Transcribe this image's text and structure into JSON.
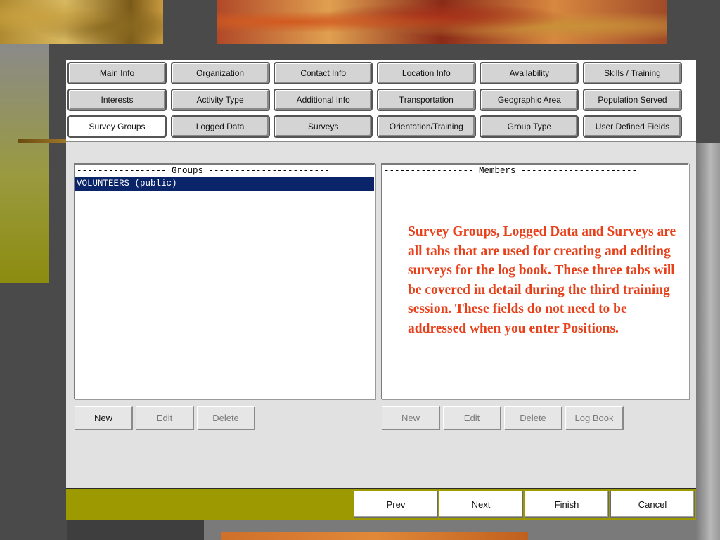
{
  "tabs": {
    "row1": [
      "Main Info",
      "Organization",
      "Contact Info",
      "Location Info",
      "Availability",
      "Skills / Training"
    ],
    "row2": [
      "Interests",
      "Activity Type",
      "Additional Info",
      "Transportation",
      "Geographic Area",
      "Population Served"
    ],
    "row3": [
      "Survey Groups",
      "Logged Data",
      "Surveys",
      "Orientation/Training",
      "Group Type",
      "User Defined Fields"
    ],
    "active": "Survey Groups"
  },
  "groups_panel": {
    "header": "----------------- Groups -----------------------",
    "items": [
      "VOLUNTEERS (public)"
    ],
    "selected_index": 0
  },
  "members_panel": {
    "header": "----------------- Members ----------------------"
  },
  "note": "Survey Groups, Logged Data and Surveys are all tabs that are used for creating and editing surveys for the log book.  These three tabs will be covered in detail during the third training session.  These fields do not need to be addressed when you enter Positions.",
  "groups_buttons": {
    "new": "New",
    "edit": "Edit",
    "delete": "Delete"
  },
  "members_buttons": {
    "new": "New",
    "edit": "Edit",
    "delete": "Delete",
    "log_book": "Log Book"
  },
  "nav": {
    "prev": "Prev",
    "next": "Next",
    "finish": "Finish",
    "cancel": "Cancel"
  },
  "colors": {
    "note_text": "#e8401a",
    "selection": "#0a246a",
    "footer": "#9c9a00"
  }
}
